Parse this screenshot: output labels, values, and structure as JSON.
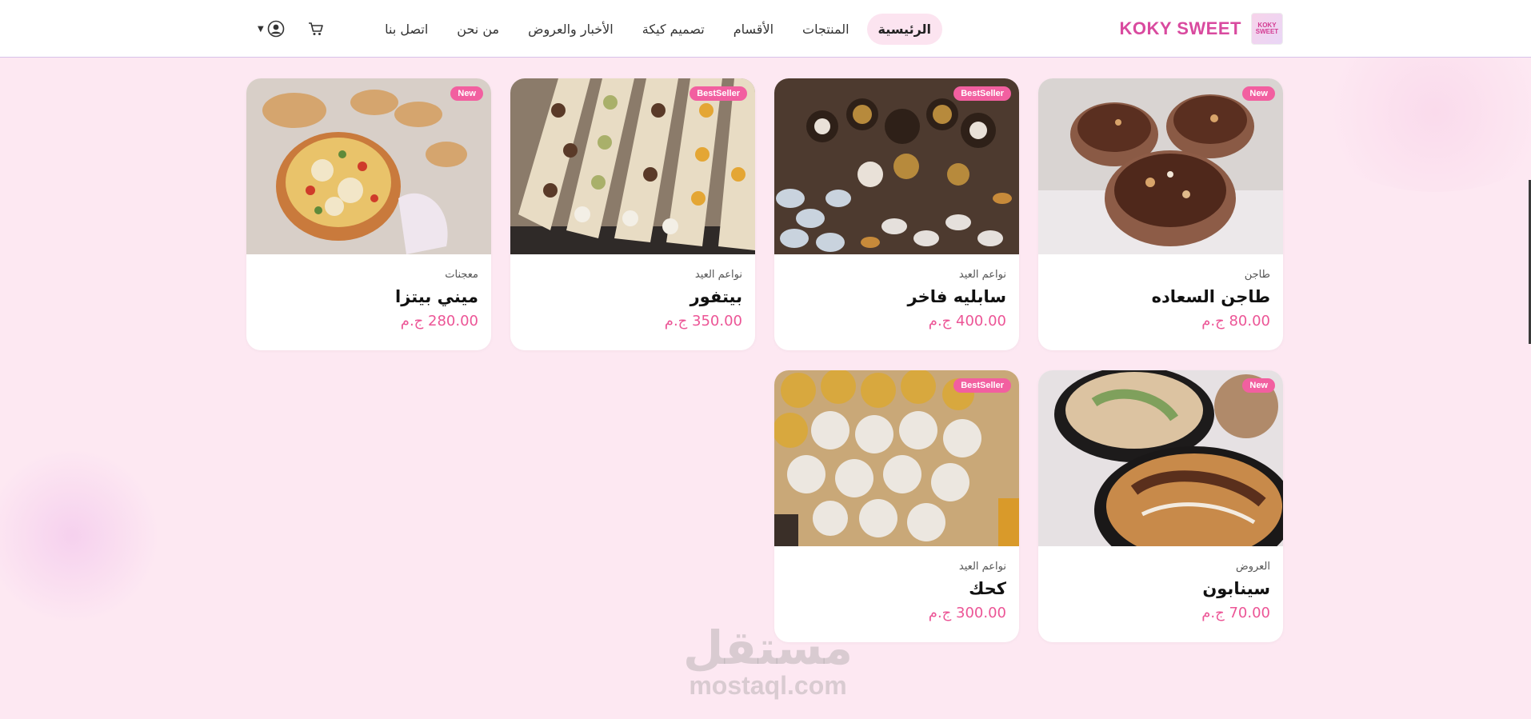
{
  "brand": {
    "name": "KOKY SWEET",
    "logo_text": "KOKY SWEET"
  },
  "nav": {
    "items": [
      {
        "label": "الرئيسية",
        "active": true
      },
      {
        "label": "المنتجات",
        "active": false
      },
      {
        "label": "الأقسام",
        "active": false
      },
      {
        "label": "تصميم كيكة",
        "active": false
      },
      {
        "label": "الأخبار والعروض",
        "active": false
      },
      {
        "label": "من نحن",
        "active": false
      },
      {
        "label": "اتصل بنا",
        "active": false
      }
    ]
  },
  "icons": {
    "cart": "cart-icon",
    "user": "user-icon",
    "caret": "caret-down-icon"
  },
  "colors": {
    "accent": "#ec5596",
    "badge": "#f25fa0",
    "brand": "#d94a9f",
    "background": "#fde8f2"
  },
  "products": [
    {
      "badge": "New",
      "category": "طاجن",
      "title": "طاجن السعاده",
      "price": "80.00 ج.م",
      "image": "tagine-chocolate"
    },
    {
      "badge": "BestSeller",
      "category": "نواعم العيد",
      "title": "سابليه فاخر",
      "price": "400.00 ج.م",
      "image": "sable-cookies"
    },
    {
      "badge": "BestSeller",
      "category": "نواعم العيد",
      "title": "بيتفور",
      "price": "350.00 ج.م",
      "image": "petit-four-box"
    },
    {
      "badge": "New",
      "category": "معجنات",
      "title": "ميني بيتزا",
      "price": "280.00 ج.م",
      "image": "mini-pizza"
    },
    {
      "badge": "New",
      "category": "العروض",
      "title": "سينابون",
      "price": "70.00 ج.م",
      "image": "cinnabon-bowls"
    },
    {
      "badge": "BestSeller",
      "category": "نواعم العيد",
      "title": "كحك",
      "price": "300.00 ج.م",
      "image": "kahk-cookies"
    }
  ],
  "watermark": {
    "arabic": "مستقل",
    "latin": "mostaql.com"
  }
}
